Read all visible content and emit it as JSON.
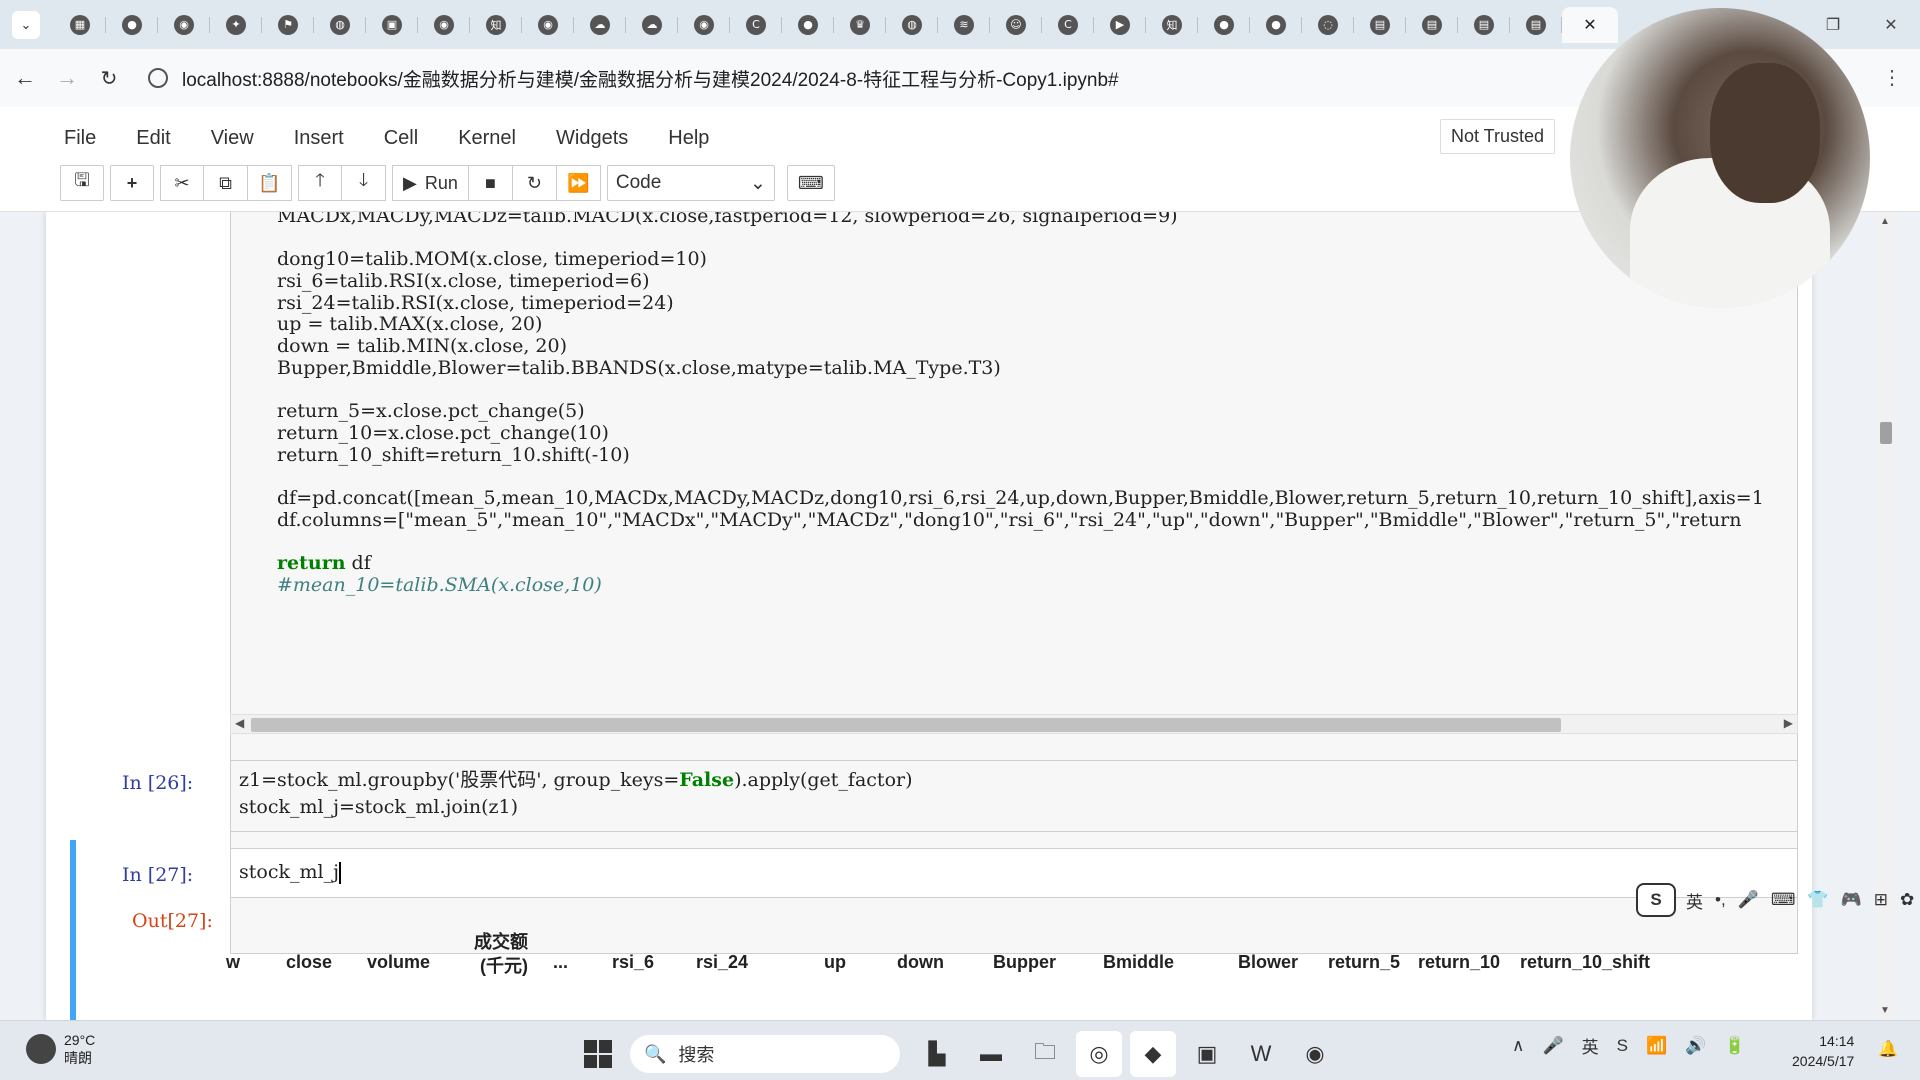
{
  "browser": {
    "tabs": [
      {
        "icon": "calendar-icon",
        "glyph": "▦"
      },
      {
        "icon": "record-icon",
        "glyph": "●"
      },
      {
        "icon": "github-icon",
        "glyph": "◉"
      },
      {
        "icon": "code-icon",
        "glyph": "✦"
      },
      {
        "icon": "translate-icon",
        "glyph": "⚑"
      },
      {
        "icon": "globe-icon",
        "glyph": "◍"
      },
      {
        "icon": "tv-icon",
        "glyph": "▣"
      },
      {
        "icon": "github-icon",
        "glyph": "◉"
      },
      {
        "icon": "zhihu-icon",
        "glyph": "知"
      },
      {
        "icon": "github-icon",
        "glyph": "◉"
      },
      {
        "icon": "cloud-icon",
        "glyph": "☁"
      },
      {
        "icon": "cloud-icon",
        "glyph": "☁"
      },
      {
        "icon": "github-icon",
        "glyph": "◉"
      },
      {
        "icon": "c-icon",
        "glyph": "C"
      },
      {
        "icon": "chat-icon",
        "glyph": "●"
      },
      {
        "icon": "crown-icon",
        "glyph": "♛"
      },
      {
        "icon": "globe-icon",
        "glyph": "◍"
      },
      {
        "icon": "stack-icon",
        "glyph": "≋"
      },
      {
        "icon": "robot-icon",
        "glyph": "☺"
      },
      {
        "icon": "c-icon",
        "glyph": "C"
      },
      {
        "icon": "video-icon",
        "glyph": "▶"
      },
      {
        "icon": "zhihu-icon",
        "glyph": "知"
      },
      {
        "icon": "bean-icon",
        "glyph": "●"
      },
      {
        "icon": "bean-icon",
        "glyph": "●"
      },
      {
        "icon": "loading-icon",
        "glyph": "◌"
      },
      {
        "icon": "book-icon",
        "glyph": "▤"
      },
      {
        "icon": "book-icon",
        "glyph": "▤"
      },
      {
        "icon": "book-icon",
        "glyph": "▤"
      },
      {
        "icon": "book-icon",
        "glyph": "▤"
      }
    ],
    "active_tab_close": "✕",
    "window_controls": [
      "—",
      "❐",
      "✕"
    ],
    "url": "localhost:8888/notebooks/金融数据分析与建模/金融数据分析与建模2024/2024-8-特征工程与分析-Copy1.ipynb#"
  },
  "jupyter": {
    "menu": [
      "File",
      "Edit",
      "View",
      "Insert",
      "Cell",
      "Kernel",
      "Widgets",
      "Help"
    ],
    "not_trusted": "Not Trusted",
    "run_label": "Run",
    "cell_type": "Code"
  },
  "cells": {
    "cell1_lines": [
      "MACDx,MACDy,MACDz=talib.MACD(x.close,fastperiod=12, slowperiod=26, signalperiod=9)",
      "",
      "dong10=talib.MOM(x.close, timeperiod=10)",
      "rsi_6=talib.RSI(x.close, timeperiod=6)",
      "rsi_24=talib.RSI(x.close, timeperiod=24)",
      "up = talib.MAX(x.close, 20)",
      "down = talib.MIN(x.close, 20)",
      "Bupper,Bmiddle,Blower=talib.BBANDS(x.close,matype=talib.MA_Type.T3)",
      "",
      "return_5=x.close.pct_change(5)",
      "return_10=x.close.pct_change(10)",
      "return_10_shift=return_10.shift(-10)",
      "",
      "df=pd.concat([mean_5,mean_10,MACDx,MACDy,MACDz,dong10,rsi_6,rsi_24,up,down,Bupper,Bmiddle,Blower,return_5,return_10,return_10_shift],axis=1",
      "df.columns=[\"mean_5\",\"mean_10\",\"MACDx\",\"MACDy\",\"MACDz\",\"dong10\",\"rsi_6\",\"rsi_24\",\"up\",\"down\",\"Bupper\",\"Bmiddle\",\"Blower\",\"return_5\",\"return",
      ""
    ],
    "cell1_return_kw": "return",
    "cell1_return_rest": " df",
    "cell1_comment": "#mean_10=talib.SMA(x.close,10)",
    "cell2_prompt": "In  [26]:",
    "cell2_line1_a": "z1=stock_ml.groupby('股票代码', group_keys=",
    "cell2_line1_kw": "False",
    "cell2_line1_b": ").apply(get_factor)",
    "cell2_line2": "stock_ml_j=stock_ml.join(z1)",
    "cell3_prompt": "In  [27]:",
    "cell3_code": "stock_ml_j",
    "out_prompt": "Out[27]:",
    "out_columns": [
      "w",
      "close",
      "volume",
      "成交额(千元)",
      "...",
      "rsi_6",
      "rsi_24",
      "up",
      "down",
      "Bupper",
      "Bmiddle",
      "Blower",
      "return_5",
      "return_10",
      "return_10_shift"
    ]
  },
  "ime": {
    "logo": "S",
    "lang": "英",
    "items": [
      "•,",
      "🎤",
      "⌨",
      "👕",
      "🎮",
      "⊞",
      "✿"
    ]
  },
  "taskbar": {
    "temp": "29°C",
    "weather": "晴朗",
    "search_placeholder": "搜索",
    "time": "14:14",
    "date": "2024/5/17",
    "tray": [
      "∧",
      "🎤",
      "英",
      "S",
      "📶",
      "🔊",
      "🔋"
    ]
  }
}
